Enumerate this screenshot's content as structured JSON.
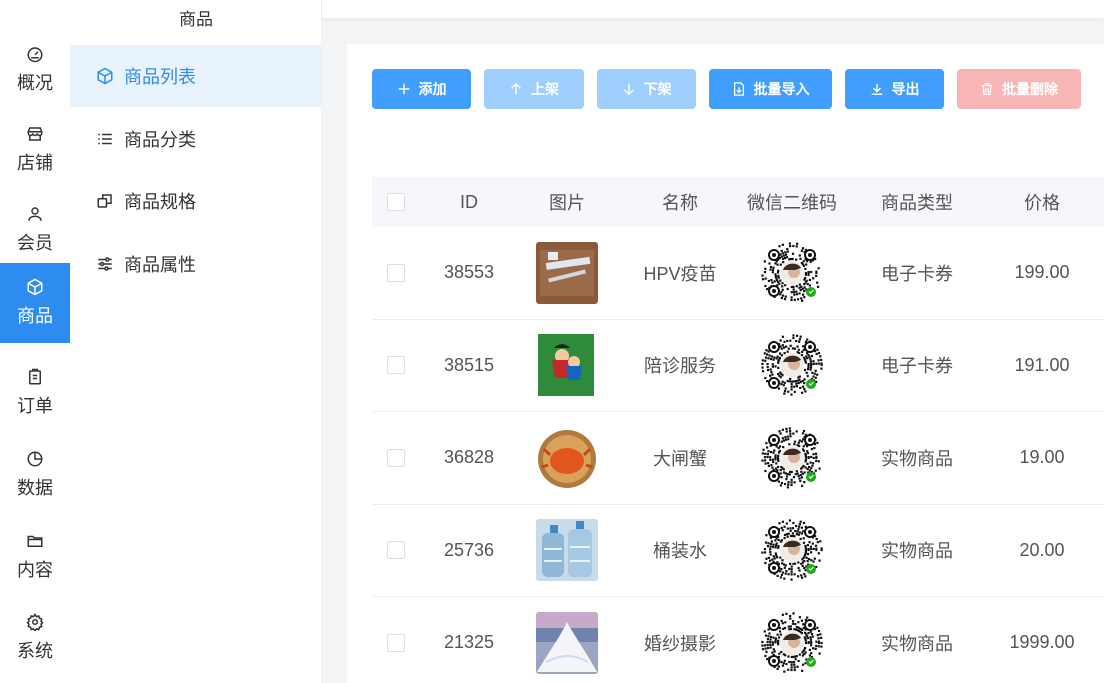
{
  "nav": {
    "items": [
      {
        "label": "概况",
        "icon": "dashboard-icon"
      },
      {
        "label": "店铺",
        "icon": "store-icon"
      },
      {
        "label": "会员",
        "icon": "user-icon"
      },
      {
        "label": "商品",
        "icon": "box-icon",
        "active": true
      },
      {
        "label": "订单",
        "icon": "clipboard-icon"
      },
      {
        "label": "数据",
        "icon": "pie-chart-icon"
      },
      {
        "label": "内容",
        "icon": "folder-icon"
      },
      {
        "label": "系统",
        "icon": "gear-icon"
      }
    ]
  },
  "sidebar": {
    "title": "商品",
    "items": [
      {
        "label": "商品列表",
        "icon": "box-icon",
        "active": true
      },
      {
        "label": "商品分类",
        "icon": "list-icon"
      },
      {
        "label": "商品规格",
        "icon": "copy-icon"
      },
      {
        "label": "商品属性",
        "icon": "sliders-icon"
      }
    ]
  },
  "toolbar": {
    "add": "添加",
    "shelve": "上架",
    "unshelve": "下架",
    "import": "批量导入",
    "export": "导出",
    "batch_delete": "批量删除"
  },
  "table": {
    "headers": {
      "id": "ID",
      "image": "图片",
      "name": "名称",
      "qr": "微信二维码",
      "type": "商品类型",
      "price": "价格"
    },
    "rows": [
      {
        "id": "38553",
        "name": "HPV疫苗",
        "type": "电子卡券",
        "price": "199.00",
        "image": "vaccine-syringe-image"
      },
      {
        "id": "38515",
        "name": "陪诊服务",
        "type": "电子卡券",
        "price": "191.00",
        "image": "escort-service-image"
      },
      {
        "id": "36828",
        "name": "大闸蟹",
        "type": "实物商品",
        "price": "19.00",
        "image": "crab-image"
      },
      {
        "id": "25736",
        "name": "桶装水",
        "type": "实物商品",
        "price": "20.00",
        "image": "water-bottle-image"
      },
      {
        "id": "21325",
        "name": "婚纱摄影",
        "type": "实物商品",
        "price": "1999.00",
        "image": "wedding-photo-image"
      }
    ]
  },
  "colors": {
    "primary": "#409eff",
    "primary_disabled": "#a0cfff",
    "danger_disabled": "#fab6b6",
    "nav_active": "#2d8cf0",
    "sidebar_active_bg": "#e8f3fe"
  }
}
